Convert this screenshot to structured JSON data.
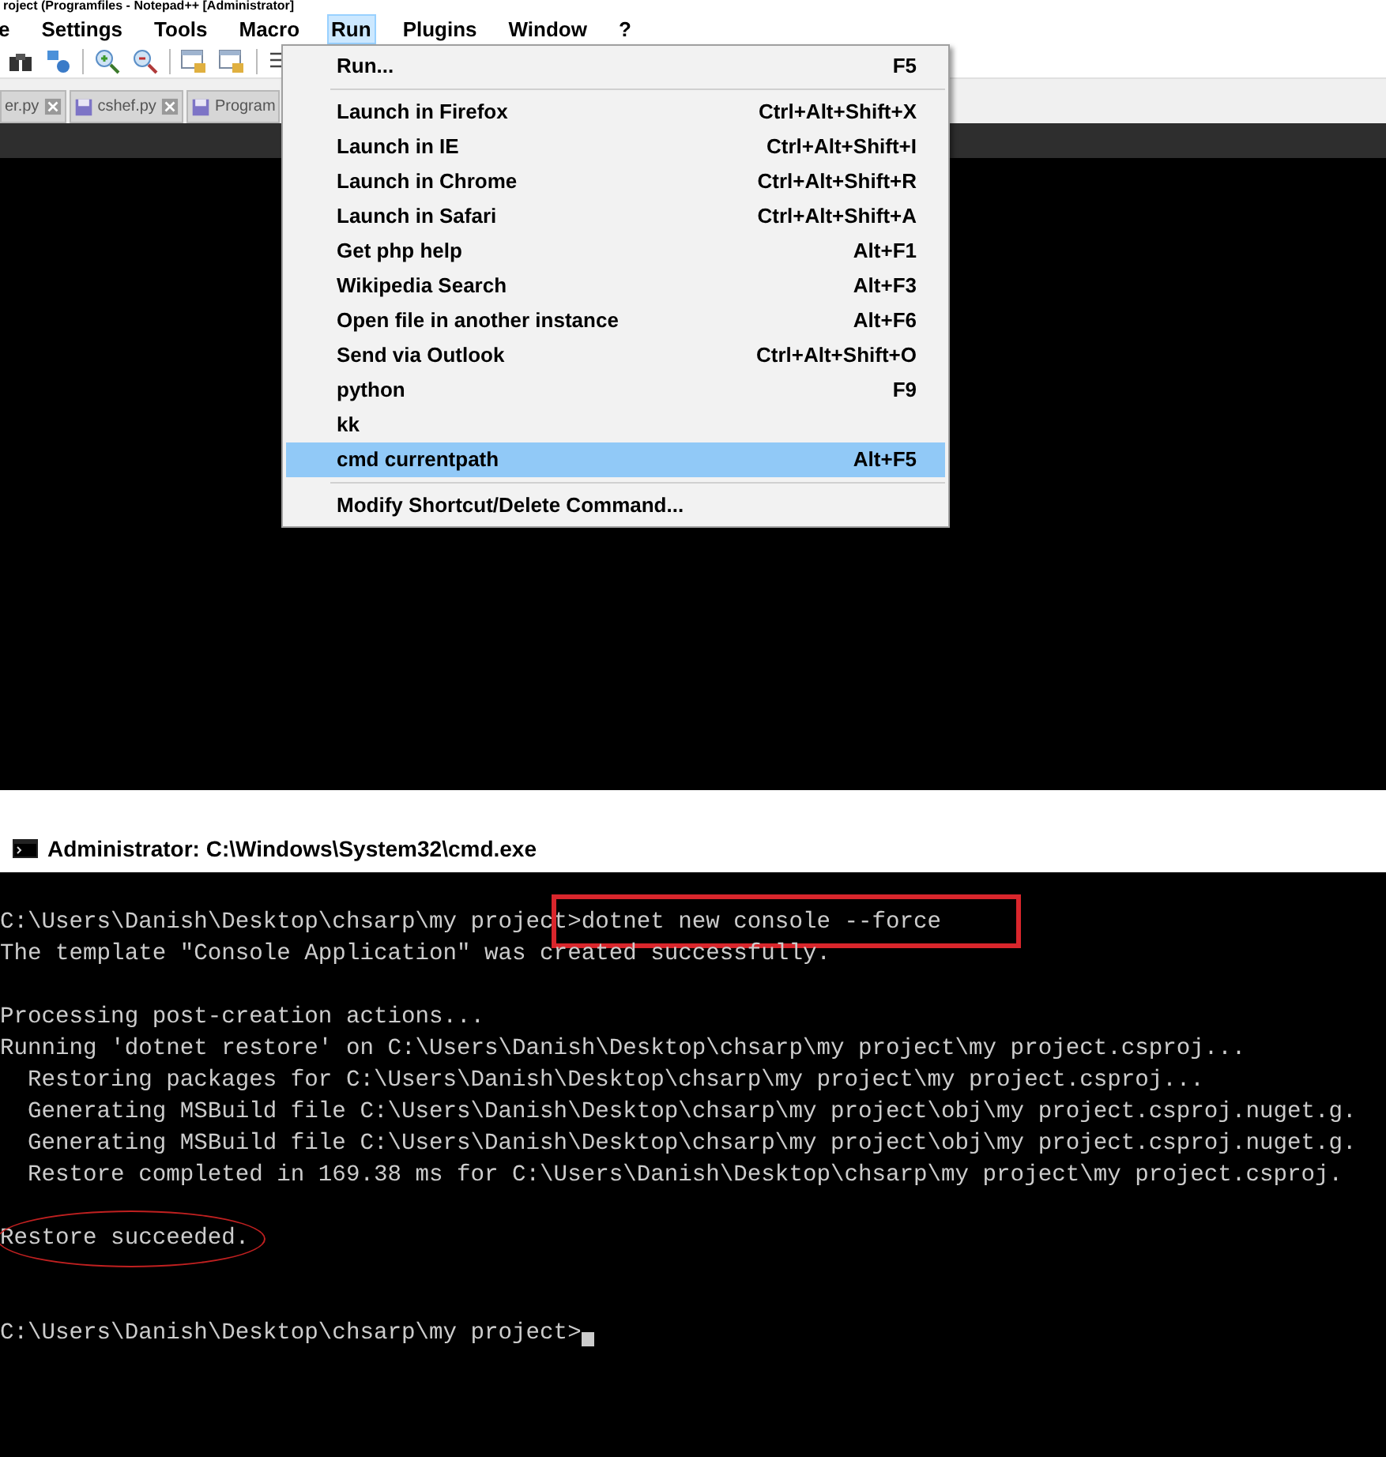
{
  "window": {
    "title": "roject (Programfiles - Notepad++ [Administrator]"
  },
  "menubar": [
    {
      "label": "e",
      "selected": false
    },
    {
      "label": "Settings",
      "selected": false
    },
    {
      "label": "Tools",
      "selected": false
    },
    {
      "label": "Macro",
      "selected": false
    },
    {
      "label": "Run",
      "selected": true
    },
    {
      "label": "Plugins",
      "selected": false
    },
    {
      "label": "Window",
      "selected": false
    },
    {
      "label": "?",
      "selected": false
    }
  ],
  "tabs": [
    {
      "label": "er.py",
      "closable": true
    },
    {
      "label": "cshef.py",
      "closable": true
    },
    {
      "label": "Program",
      "closable": false
    }
  ],
  "run_menu": [
    {
      "label": "Run...",
      "shortcut": "F5",
      "selected": false,
      "separator_after": true
    },
    {
      "label": "Launch in Firefox",
      "shortcut": "Ctrl+Alt+Shift+X",
      "selected": false,
      "separator_after": false
    },
    {
      "label": "Launch in IE",
      "shortcut": "Ctrl+Alt+Shift+I",
      "selected": false,
      "separator_after": false
    },
    {
      "label": "Launch in Chrome",
      "shortcut": "Ctrl+Alt+Shift+R",
      "selected": false,
      "separator_after": false
    },
    {
      "label": "Launch in Safari",
      "shortcut": "Ctrl+Alt+Shift+A",
      "selected": false,
      "separator_after": false
    },
    {
      "label": "Get php help",
      "shortcut": "Alt+F1",
      "selected": false,
      "separator_after": false
    },
    {
      "label": "Wikipedia Search",
      "shortcut": "Alt+F3",
      "selected": false,
      "separator_after": false
    },
    {
      "label": "Open file in another instance",
      "shortcut": "Alt+F6",
      "selected": false,
      "separator_after": false
    },
    {
      "label": "Send via Outlook",
      "shortcut": "Ctrl+Alt+Shift+O",
      "selected": false,
      "separator_after": false
    },
    {
      "label": "python",
      "shortcut": "F9",
      "selected": false,
      "separator_after": false
    },
    {
      "label": "kk",
      "selected": false,
      "separator_after": false
    },
    {
      "label": "cmd currentpath",
      "shortcut": "Alt+F5",
      "selected": true,
      "separator_after": true
    },
    {
      "label": "Modify Shortcut/Delete Command...",
      "selected": false,
      "separator_after": false
    }
  ],
  "console": {
    "title": "Administrator: C:\\Windows\\System32\\cmd.exe",
    "blocks": [
      {
        "lines": [
          {
            "text": "C:\\Users\\Danish\\Desktop\\chsarp\\my project>dotnet new console --force",
            "boxed": true
          },
          {
            "text": "The template \"Console Application\" was created successfully."
          }
        ]
      },
      {
        "lines": [
          {
            "text": "Processing post-creation actions..."
          },
          {
            "text": "Running 'dotnet restore' on C:\\Users\\Danish\\Desktop\\chsarp\\my project\\my project.csproj..."
          },
          {
            "text": "  Restoring packages for C:\\Users\\Danish\\Desktop\\chsarp\\my project\\my project.csproj..."
          },
          {
            "text": "  Generating MSBuild file C:\\Users\\Danish\\Desktop\\chsarp\\my project\\obj\\my project.csproj.nuget.g."
          },
          {
            "text": "  Generating MSBuild file C:\\Users\\Danish\\Desktop\\chsarp\\my project\\obj\\my project.csproj.nuget.g."
          },
          {
            "text": "  Restore completed in 169.38 ms for C:\\Users\\Danish\\Desktop\\chsarp\\my project\\my project.csproj."
          }
        ]
      },
      {
        "lines": [
          {
            "text": "Restore succeeded.",
            "circled": true
          }
        ]
      },
      {
        "lines": [
          {
            "text": "C:\\Users\\Danish\\Desktop\\chsarp\\my project>",
            "cursor": true
          }
        ]
      }
    ]
  }
}
